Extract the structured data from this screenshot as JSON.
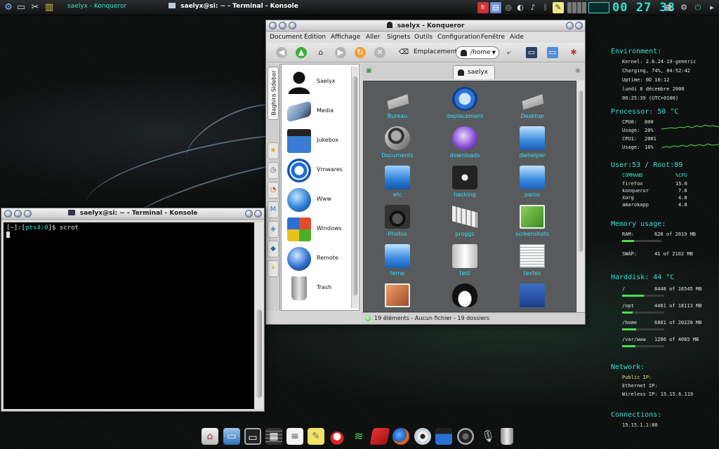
{
  "top_panel": {
    "tasks": [
      {
        "label": "saelyx - Konqueror",
        "active": false
      },
      {
        "label": "saelyx@si: ~ - Terminal - Konsole",
        "active": true
      }
    ],
    "clock": "00 27 38"
  },
  "konqueror": {
    "title": "saelyx - Konqueror",
    "menu": [
      "Document",
      "Édition",
      "Affichage",
      "Aller",
      "Signets",
      "Outils",
      "Configuration",
      "Fenêtre",
      "Aide"
    ],
    "location_label": "Emplacement :",
    "location_value": "/home",
    "sidebar_tab": "Baghira Sidebar",
    "sidebar_items": [
      "Saelyx",
      "Media",
      "Jukebox",
      "Vmwares",
      "Www",
      "Windows",
      "Remote",
      "Trash"
    ],
    "tab_label": "saelyx",
    "files": [
      "Bureau",
      "deplacement",
      "Desktop",
      "Documents",
      "downloads",
      "dwhelper",
      "etc",
      "hacking",
      "paros",
      "Photos",
      "proggz",
      "screenshots",
      "temp",
      "test",
      "textes",
      "",
      "",
      ""
    ],
    "status": "19 éléments - Aucun fichier - 19 dossiers"
  },
  "konsole": {
    "title": "saelyx@si: ~ - Terminal - Konsole",
    "prompt_prefix": "[~]:[",
    "prompt_tty": "pts4:0",
    "prompt_suffix": "]$ scrot"
  },
  "conky": {
    "environment": {
      "heading": "Environment:",
      "lines": [
        "Kernel:    2.6.24-19-generic",
        "Charging, 74%, 04:52:42",
        "Uptime:    0D 10:12",
        "lundi 8 décembre 2008",
        "00:25:39 (UTC+0100)"
      ]
    },
    "processor": {
      "heading": "Processor:  50 °C",
      "cpu0_label": "CPU0:",
      "cpu0_value": "800",
      "usage0_label": "Usage:",
      "usage0_value": "20%",
      "cpu1_label": "CPU1:",
      "cpu1_value": "2001",
      "usage1_label": "Usage:",
      "usage1_value": "16%"
    },
    "users": {
      "heading": "User:53 / Root:89",
      "col_command": "COMMAND",
      "col_cpu": "%CPU",
      "rows": [
        {
          "name": "firefox",
          "cpu": "15.0"
        },
        {
          "name": "konqueror",
          "cpu": "7.6"
        },
        {
          "name": "Xorg",
          "cpu": "4.8"
        },
        {
          "name": "amarokapp",
          "cpu": "4.8"
        }
      ]
    },
    "memory": {
      "heading": "Memory usage:",
      "ram_label": "RAM:",
      "ram_value": "628 of 2019 MB",
      "ram_fraction": 0.31,
      "swap_label": "SWAP:",
      "swap_value": "41 of 2102 MB",
      "swap_fraction": 0.02
    },
    "harddisk": {
      "heading": "Harddisk: 44 °C",
      "disks": [
        {
          "mount": "/",
          "usage": "8448 of 16545 MB",
          "fraction": 0.51
        },
        {
          "mount": "/opt",
          "usage": "4461 of 18113 MB",
          "fraction": 0.25
        },
        {
          "mount": "/home",
          "usage": "6881 of 20220 MB",
          "fraction": 0.34
        },
        {
          "mount": "/var/www",
          "usage": "1286 of 4085 MB",
          "fraction": 0.31
        }
      ]
    },
    "network": {
      "heading": "Network:",
      "lines": [
        "Public IP:",
        "Ethernet IP:",
        "Wireless IP: 15.15.6.119"
      ]
    },
    "connections": {
      "heading": "Connections:",
      "lines": [
        "15.15.1.1:80"
      ]
    }
  },
  "colors": {
    "accent_cyan": "#2fe3cc",
    "file_label": "#35e0ff",
    "bar_green": "#4ae04a",
    "window_chrome": "#d6d6d6"
  },
  "dock_icons": [
    "home-icon",
    "laptop-icon",
    "monitor-icon",
    "calculator-icon",
    "document-icon",
    "sticky-note-icon",
    "redhat-icon",
    "wifi-icon",
    "book-icon",
    "firefox-icon",
    "cd-icon",
    "video-icon",
    "speaker-icon",
    "microphone-icon",
    "trash-icon"
  ]
}
